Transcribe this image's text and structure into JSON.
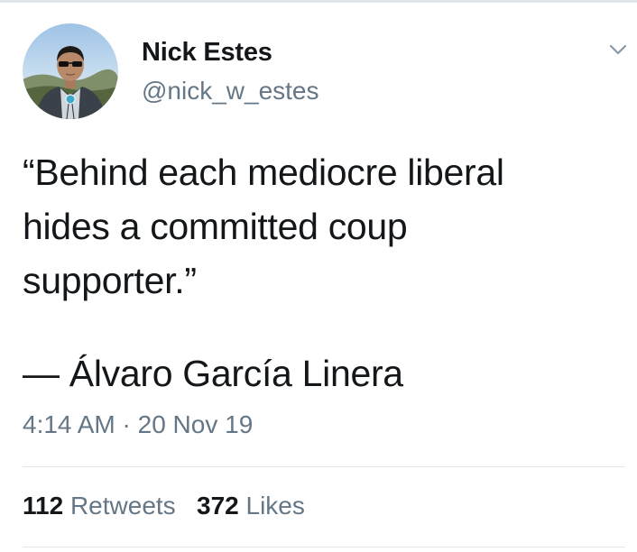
{
  "tweet": {
    "author": {
      "display_name": "Nick Estes",
      "handle": "@nick_w_estes",
      "avatar_icon": "profile-photo"
    },
    "menu_icon": "chevron-down-icon",
    "text": "“Behind each mediocre liberal\nhides a committed coup\nsupporter.”",
    "attribution": "— Álvaro García Linera",
    "time": "4:14 AM",
    "separator": "·",
    "date": "20 Nov 19",
    "stats": {
      "retweets_count": "112",
      "retweets_label": "Retweets",
      "likes_count": "372",
      "likes_label": "Likes"
    }
  },
  "colors": {
    "text_primary": "#14171a",
    "text_secondary": "#657786",
    "divider": "#e1e8ed"
  }
}
